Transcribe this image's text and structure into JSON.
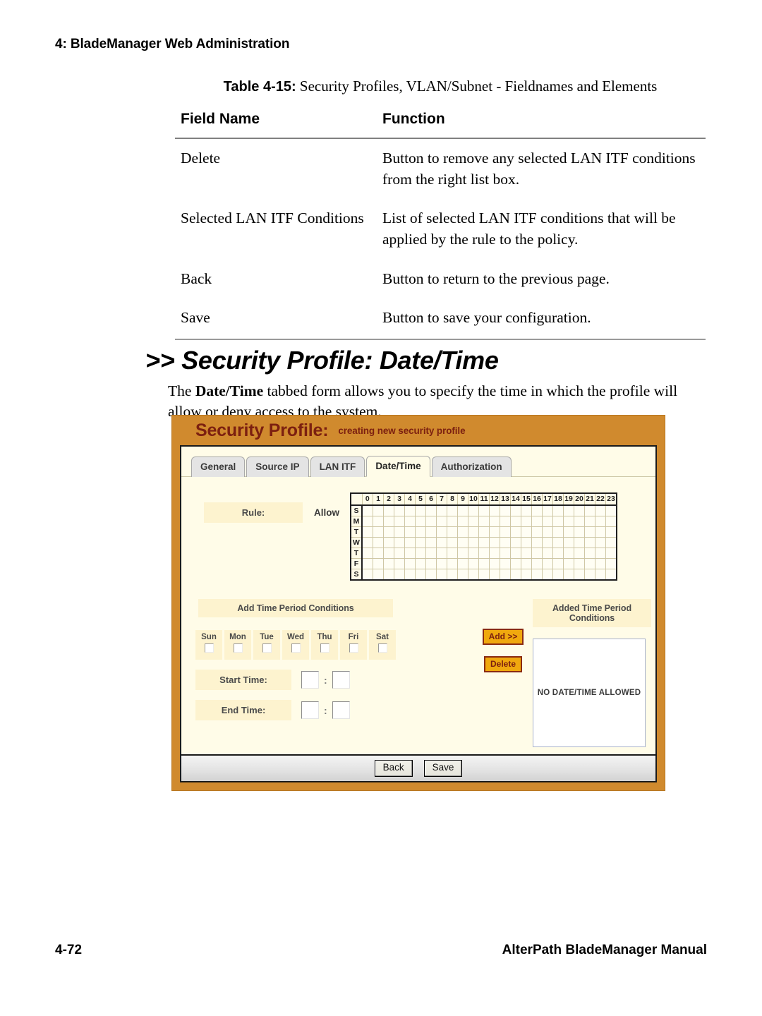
{
  "page": {
    "running_head": "4: BladeManager Web Administration",
    "folio": "4-72",
    "manual_title": "AlterPath BladeManager Manual"
  },
  "table": {
    "caption_label": "Table 4-15:",
    "caption_text": " Security Profiles, VLAN/Subnet - Fieldnames and Elements",
    "headers": [
      "Field Name",
      "Function"
    ],
    "rows": [
      {
        "field": "Delete",
        "function": "Button to remove any selected LAN ITF conditions from the right list box."
      },
      {
        "field": "Selected LAN ITF Conditions",
        "function": "List of selected LAN ITF conditions that will be applied by the rule to the policy."
      },
      {
        "field": "Back",
        "function": "Button to return to the previous page."
      },
      {
        "field": "Save",
        "function": "Button to save your configuration."
      }
    ]
  },
  "section": {
    "heading": ">> Security Profile: Date/Time",
    "intro_before": "The ",
    "intro_bold": "Date/Time",
    "intro_after": " tabbed form allows you to specify the time in which the profile will allow or deny access to the system."
  },
  "screenshot": {
    "title": "Security Profile:",
    "subtitle": "creating new security profile",
    "tabs": [
      {
        "label": "General",
        "active": false
      },
      {
        "label": "Source IP",
        "active": false
      },
      {
        "label": "LAN ITF",
        "active": false
      },
      {
        "label": "Date/Time",
        "active": true
      },
      {
        "label": "Authorization",
        "active": false
      }
    ],
    "rule": {
      "label": "Rule:",
      "value": "Allow"
    },
    "timegrid": {
      "hours": [
        "0",
        "1",
        "2",
        "3",
        "4",
        "5",
        "6",
        "7",
        "8",
        "9",
        "10",
        "11",
        "12",
        "13",
        "14",
        "15",
        "16",
        "17",
        "18",
        "19",
        "20",
        "21",
        "22",
        "23"
      ],
      "days": [
        "S",
        "M",
        "T",
        "W",
        "T",
        "F",
        "S"
      ],
      "selected_cells": []
    },
    "add_panel": {
      "heading": "Add Time Period Conditions",
      "days": [
        {
          "label": "Sun",
          "checked": false
        },
        {
          "label": "Mon",
          "checked": false
        },
        {
          "label": "Tue",
          "checked": false
        },
        {
          "label": "Wed",
          "checked": false
        },
        {
          "label": "Thu",
          "checked": false
        },
        {
          "label": "Fri",
          "checked": false
        },
        {
          "label": "Sat",
          "checked": false
        }
      ],
      "start_time": {
        "label": "Start Time:",
        "hour": "",
        "minute": "",
        "separator": ":"
      },
      "end_time": {
        "label": "End Time:",
        "hour": "",
        "minute": "",
        "separator": ":"
      }
    },
    "transfer_buttons": {
      "add": "Add >>",
      "delete": "Delete"
    },
    "added_panel": {
      "heading": "Added Time Period Conditions",
      "list_text": "NO DATE/TIME ALLOWED"
    },
    "actions": {
      "back": "Back",
      "save": "Save"
    },
    "colors": {
      "header_orange": "#d08a2e",
      "header_text": "#7c2010",
      "panel_cream": "#fffce8",
      "label_cream": "#fdf3cf",
      "button_orange": "#f0a80e",
      "button_border": "#8a2b10"
    }
  }
}
